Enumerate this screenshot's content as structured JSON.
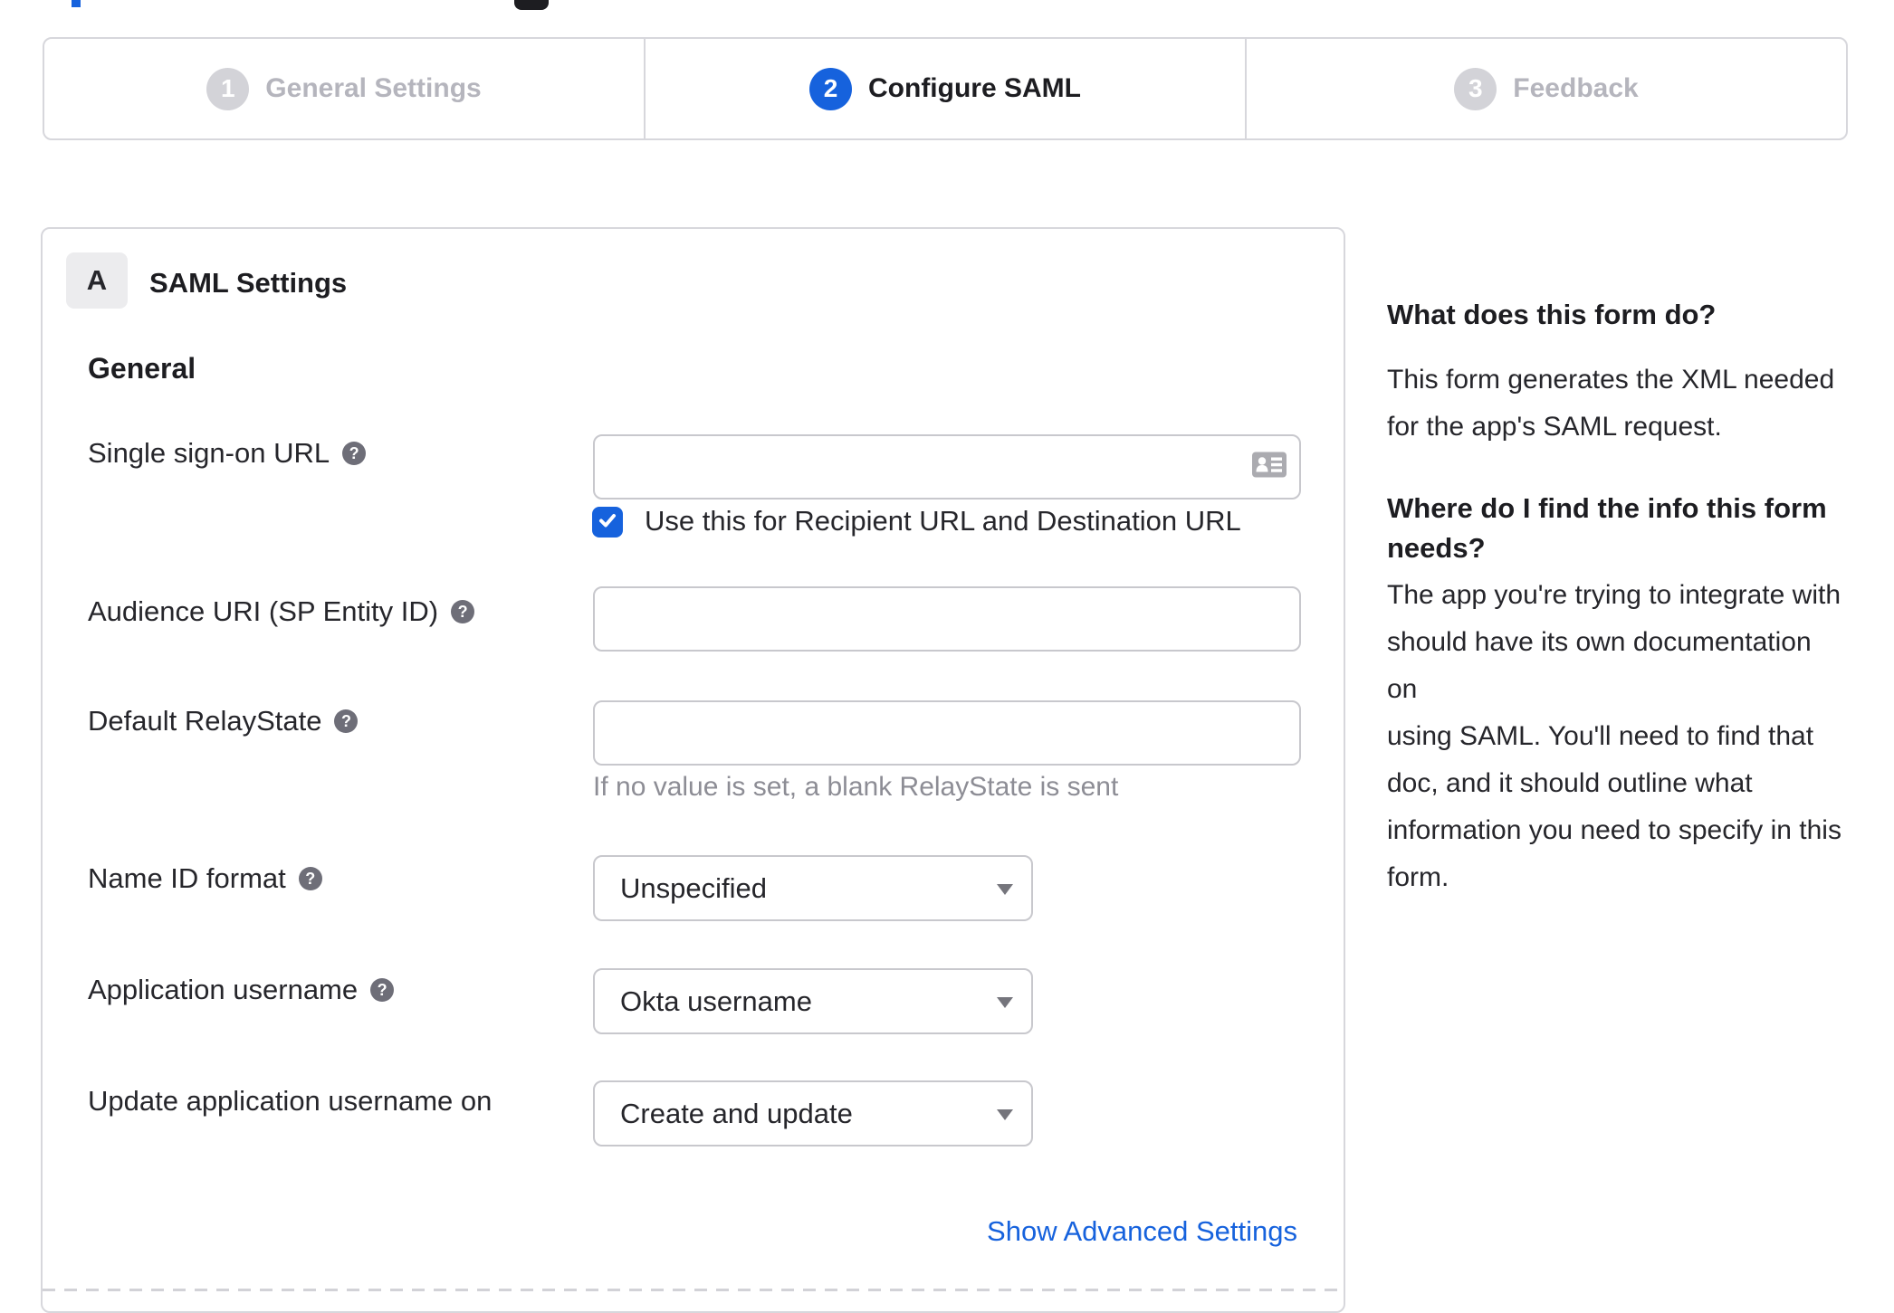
{
  "glyphs": {
    "help": "?"
  },
  "colors": {
    "accent": "#1662dd",
    "inactive_step_text": "#b5b5bd",
    "inactive_step_circle": "#d3d3d8",
    "card_border": "#d7d7dc",
    "field_border": "#c8c8cd",
    "text": "#26262b",
    "muted": "#8d8d95",
    "help_icon_bg": "#6e6e78",
    "input_icon_gray": "#ababb0"
  },
  "stepper": {
    "steps": [
      {
        "number": "1",
        "label": "General Settings"
      },
      {
        "number": "2",
        "label": "Configure SAML"
      },
      {
        "number": "3",
        "label": "Feedback"
      }
    ]
  },
  "panel": {
    "badge": "A",
    "title": "SAML Settings",
    "section": "General",
    "sso": {
      "label": "Single sign-on URL",
      "value": "",
      "checkbox_label": "Use this for Recipient URL and Destination URL"
    },
    "audience": {
      "label": "Audience URI (SP Entity ID)",
      "value": ""
    },
    "relay": {
      "label": "Default RelayState",
      "value": "",
      "hint": "If no value is set, a blank RelayState is sent"
    },
    "nameid": {
      "label": "Name ID format",
      "value": "Unspecified"
    },
    "appuser": {
      "label": "Application username",
      "value": "Okta username"
    },
    "updateuser": {
      "label": "Update application username on",
      "value": "Create and update"
    },
    "advanced_link": "Show Advanced Settings"
  },
  "help_col": {
    "q1": "What does this form do?",
    "a1": "This form generates the XML needed\nfor the app's SAML request.",
    "q2": "Where do I find the info this form\nneeds?",
    "a2": "The app you're trying to integrate with\nshould have its own documentation on\nusing SAML. You'll need to find that\ndoc, and it should outline what\ninformation you need to specify in this\nform."
  }
}
